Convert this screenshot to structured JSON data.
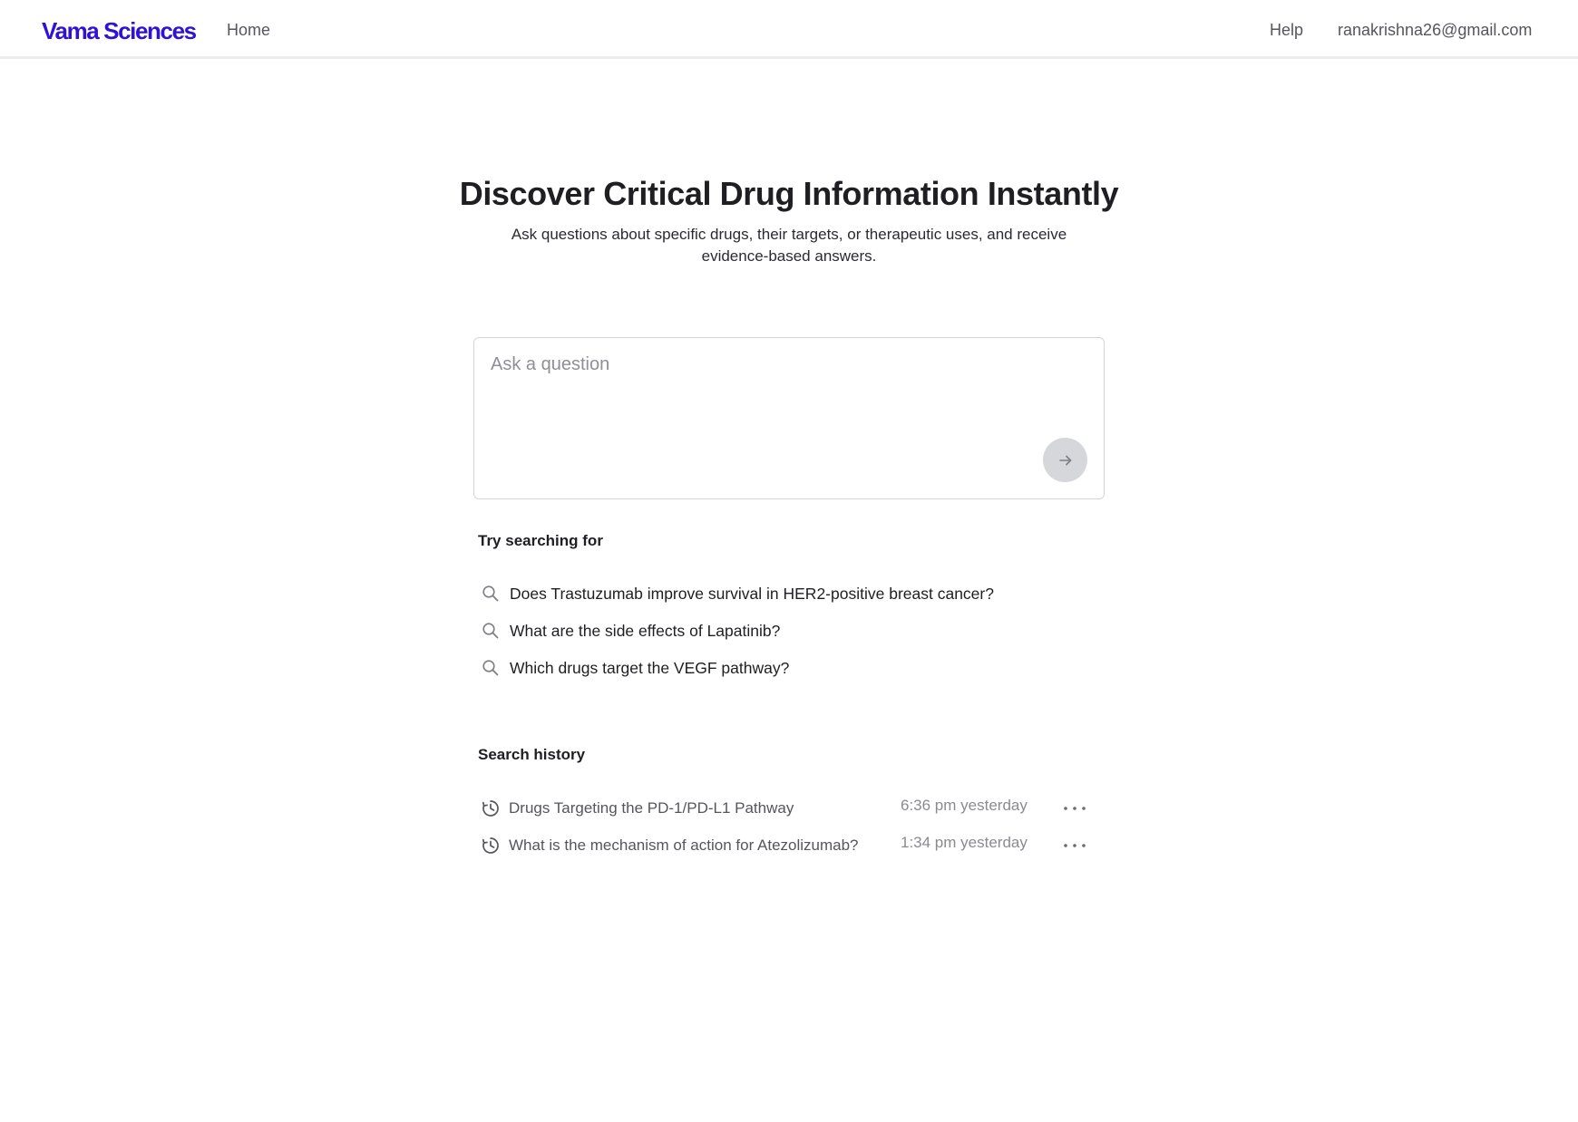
{
  "header": {
    "brand": "Vama Sciences",
    "nav_home": "Home",
    "nav_help": "Help",
    "user_email": "ranakrishna26@gmail.com",
    "brand_color": "#2f13d4"
  },
  "hero": {
    "title": "Discover Critical Drug Information Instantly",
    "subtitle": "Ask questions about specific drugs, their targets, or therapeutic uses, and receive evidence-based answers."
  },
  "search": {
    "placeholder": "Ask a question",
    "value": "",
    "submit_icon": "arrow-right-icon"
  },
  "suggestions": {
    "heading": "Try searching for",
    "icon": "search-icon",
    "items": [
      {
        "label": "Does Trastuzumab improve survival in HER2-positive breast cancer?"
      },
      {
        "label": "What are the side effects of Lapatinib?"
      },
      {
        "label": "Which drugs target the VEGF pathway?"
      }
    ]
  },
  "history": {
    "heading": "Search history",
    "icon": "clock-icon",
    "more_icon": "more-horizontal-icon",
    "items": [
      {
        "label": "Drugs Targeting the PD-1/PD-L1 Pathway",
        "time": "6:36 pm yesterday"
      },
      {
        "label": "What is the mechanism of action for Atezolizumab?",
        "time": "1:34 pm yesterday"
      }
    ]
  }
}
